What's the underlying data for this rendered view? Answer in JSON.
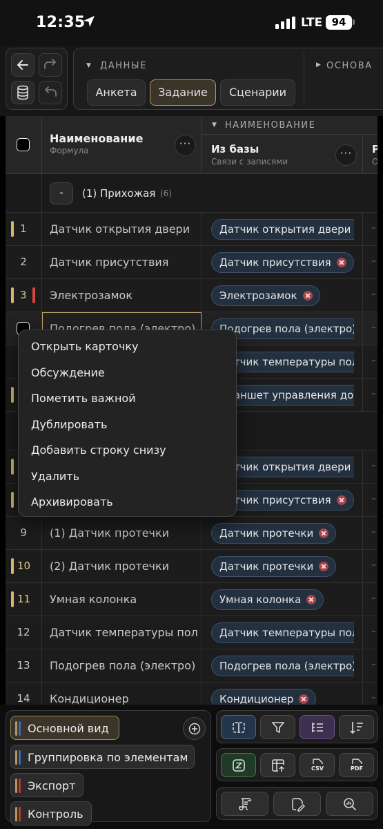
{
  "status_bar": {
    "time": "12:35",
    "network": "LTE",
    "battery": "94"
  },
  "toolbar": {
    "data_group_title": "ДАННЫЕ",
    "base_group_title": "ОСНОВА",
    "tabs": [
      {
        "label": "Анкета",
        "active": false
      },
      {
        "label": "Задание",
        "active": true
      },
      {
        "label": "Сценарии",
        "active": false
      }
    ]
  },
  "table": {
    "section_title": "НАИМЕНОВАНИЕ",
    "columns": [
      {
        "title": "Наименование",
        "subtitle": "Формула"
      },
      {
        "title": "Из базы",
        "subtitle": "Связи с записями"
      },
      {
        "title": "Р",
        "subtitle": "О"
      }
    ],
    "group": {
      "toggle": "-",
      "title": "(1) Прихожая",
      "count": "(6)"
    },
    "rows": [
      {
        "num": "1",
        "name": "Датчик открытия двери",
        "link": "Датчик открытия двери"
      },
      {
        "num": "2",
        "name": "Датчик присутствия",
        "link": "Датчик присутствия"
      },
      {
        "num": "3",
        "name": "Электрозамок",
        "link": "Электрозамок"
      },
      {
        "num": "",
        "name": "Подогрев пола (электро)",
        "link": "Подогрев пола (электро)"
      },
      {
        "num": "",
        "name": "",
        "link": "Датчик температуры пола"
      },
      {
        "num": "",
        "name": "",
        "link": "Планшет управления дом"
      },
      {
        "num": "",
        "name": "",
        "link": "Датчик открытия двери"
      },
      {
        "num": "",
        "name": "",
        "link": "Датчик присутствия"
      },
      {
        "num": "9",
        "name": "(1) Датчик протечки",
        "link": "Датчик протечки"
      },
      {
        "num": "10",
        "name": "(2) Датчик протечки",
        "link": "Датчик протечки"
      },
      {
        "num": "11",
        "name": "Умная колонка",
        "link": "Умная колонка"
      },
      {
        "num": "12",
        "name": "Датчик температуры пол",
        "link": "Датчик температуры пола"
      },
      {
        "num": "13",
        "name": "Подогрев пола (электро)",
        "link": "Подогрев пола (электро)"
      },
      {
        "num": "14",
        "name": "Кондиционер",
        "link": "Кондиционер"
      }
    ],
    "placeholder": "–"
  },
  "context_menu": {
    "items": [
      "Открыть карточку",
      "Обсуждение",
      "Пометить важной",
      "Дублировать",
      "Добавить строку снизу",
      "Удалить",
      "Архивировать"
    ]
  },
  "views": [
    {
      "label": "Основной вид",
      "active": true,
      "color": "#3a67c4"
    },
    {
      "label": "Группировка по элементам",
      "active": false,
      "color": "#3a67c4"
    },
    {
      "label": "Экспорт",
      "active": false,
      "color": "#b03a3a"
    },
    {
      "label": "Контроль",
      "active": false,
      "color": "#b03a3a"
    }
  ],
  "export_buttons": {
    "csv": "CSV",
    "pdf": "PDF"
  },
  "colors": {
    "accent_gold": "#b8975a",
    "mark_red": "#d9453d",
    "chip_bg": "#23303f",
    "chip_x": "#a8424a"
  }
}
